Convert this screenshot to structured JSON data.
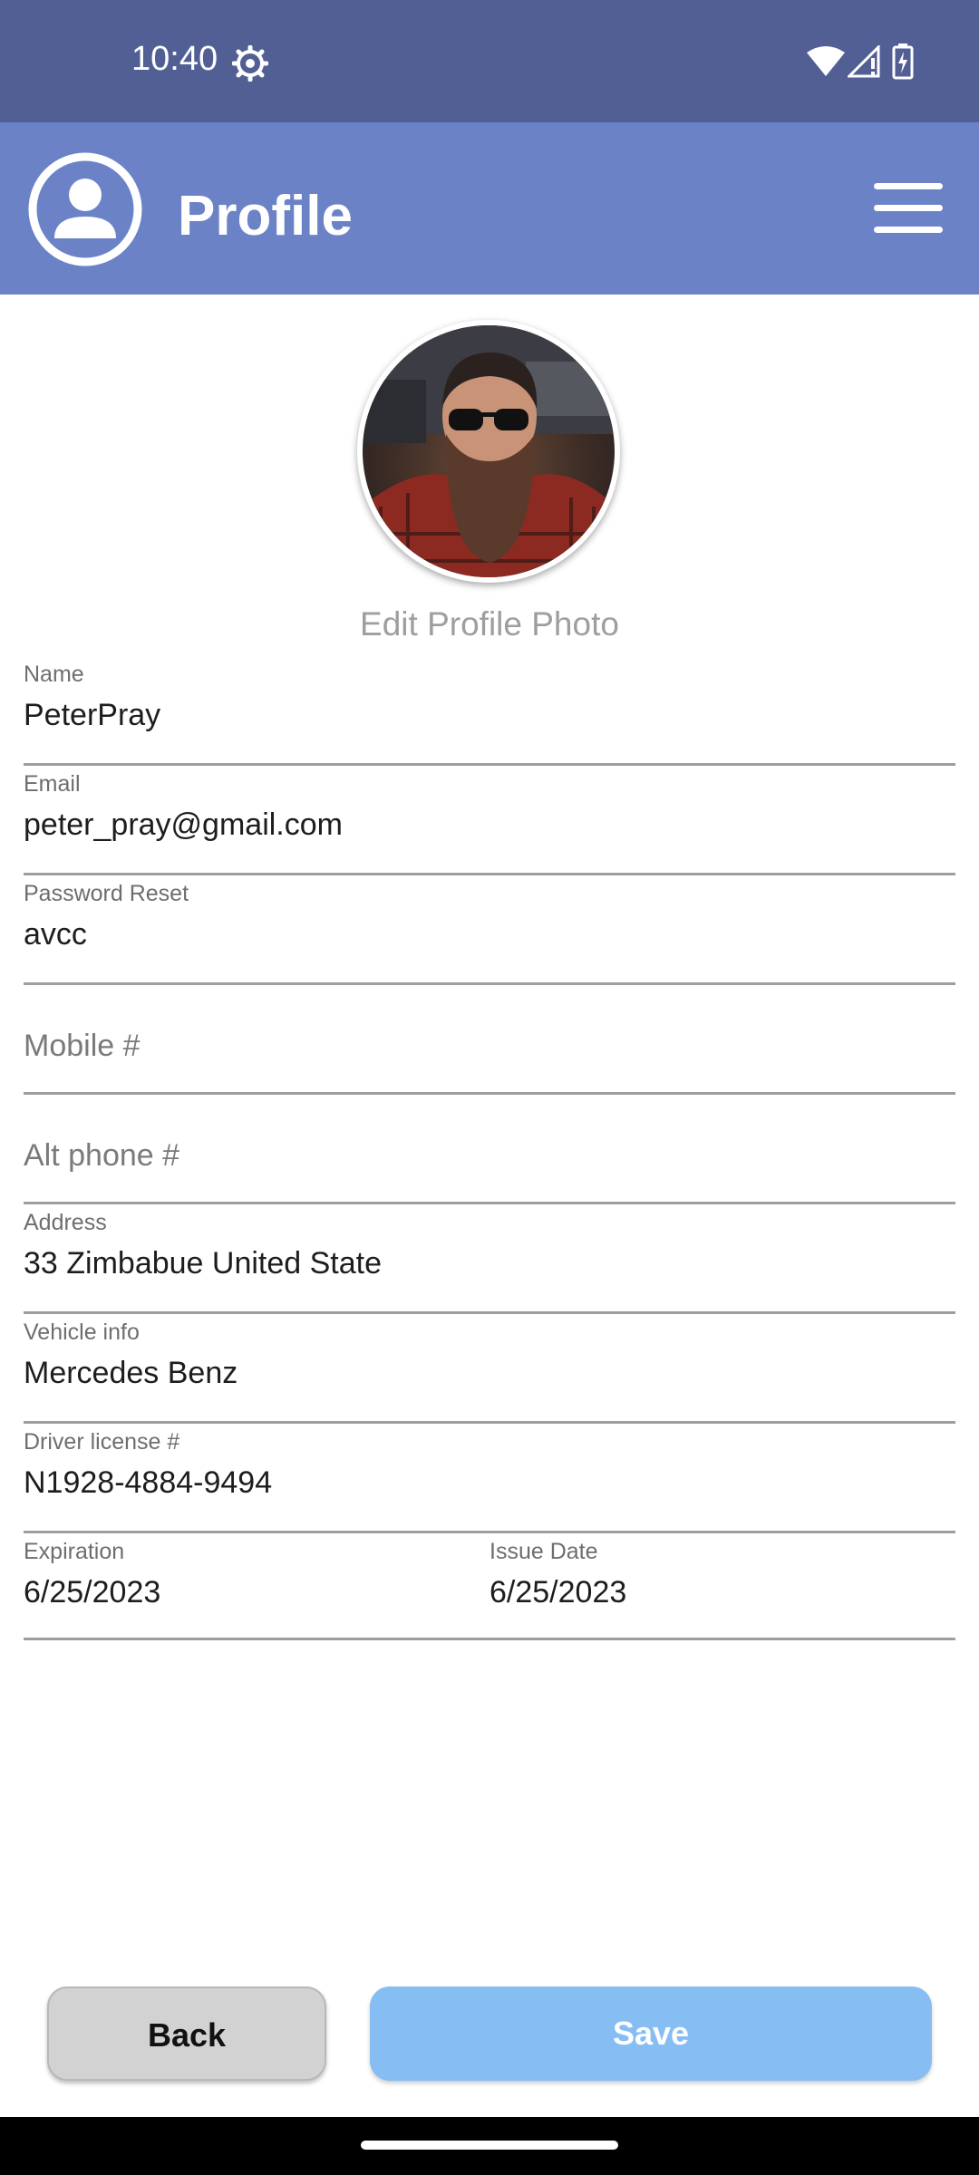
{
  "status_bar": {
    "time": "10:40"
  },
  "app_bar": {
    "title": "Profile",
    "avatar_icon": "account-circle-icon",
    "menu_icon": "hamburger-menu-icon"
  },
  "profile_photo": {
    "edit_label": "Edit Profile Photo"
  },
  "form": {
    "name": {
      "label": "Name",
      "value": "PeterPray"
    },
    "email": {
      "label": "Email",
      "value": "peter_pray@gmail.com"
    },
    "password_reset": {
      "label": "Password Reset",
      "value": "avcc"
    },
    "mobile": {
      "placeholder": "Mobile #",
      "value": ""
    },
    "alt_phone": {
      "placeholder": "Alt phone #",
      "value": ""
    },
    "address": {
      "label": "Address",
      "value": "33 Zimbabue United State"
    },
    "vehicle_info": {
      "label": "Vehicle info",
      "value": "Mercedes Benz"
    },
    "driver_license": {
      "label": "Driver license #",
      "value": "N1928-4884-9494"
    },
    "expiration": {
      "label": "Expiration",
      "value": "6/25/2023"
    },
    "issue_date": {
      "label": "Issue Date",
      "value": "6/25/2023"
    }
  },
  "buttons": {
    "back": "Back",
    "save": "Save"
  },
  "colors": {
    "status_bar": "#515f94",
    "app_bar": "#6b82c6",
    "save_button": "#86bdf3",
    "back_button": "#d2d2d2"
  }
}
